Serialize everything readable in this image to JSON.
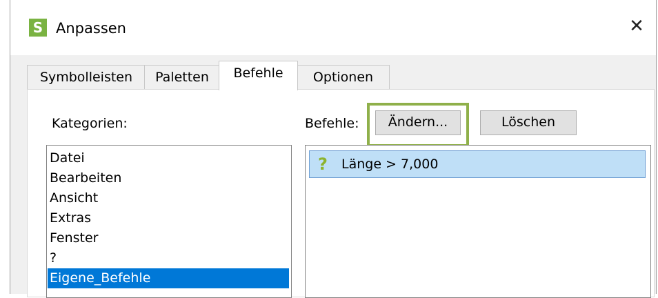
{
  "window": {
    "title": "Anpassen",
    "app_icon_letter": "S",
    "close_glyph": "✕"
  },
  "tabs": [
    {
      "label": "Symbolleisten",
      "active": false
    },
    {
      "label": "Paletten",
      "active": false
    },
    {
      "label": "Befehle",
      "active": true
    },
    {
      "label": "Optionen",
      "active": false
    }
  ],
  "categories": {
    "label": "Kategorien:",
    "items": [
      "Datei",
      "Bearbeiten",
      "Ansicht",
      "Extras",
      "Fenster",
      "?",
      "Eigene_Befehle"
    ],
    "selected": "Eigene_Befehle"
  },
  "commands": {
    "label": "Befehle:",
    "change_button": "Ändern...",
    "delete_button": "Löschen",
    "items": [
      {
        "icon": "question-icon",
        "glyph": "?",
        "label": "Länge > 7,000",
        "selected": true
      }
    ]
  },
  "colors": {
    "accent_green": "#8fb04a",
    "selection_blue": "#0078d7",
    "row_highlight": "#bfdff7"
  }
}
